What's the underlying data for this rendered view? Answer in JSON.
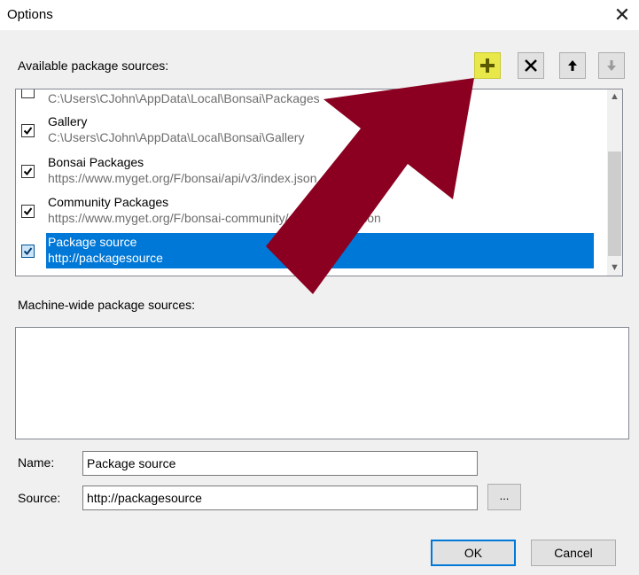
{
  "window": {
    "title": "Options",
    "close_glyph": "✕"
  },
  "available": {
    "label": "Available package sources:",
    "toolbar": [
      {
        "name": "add-source-button",
        "icon": "plus-icon"
      },
      {
        "name": "remove-source-button",
        "icon": "x-icon"
      },
      {
        "name": "move-up-button",
        "icon": "arrow-up-icon"
      },
      {
        "name": "move-down-button",
        "icon": "arrow-down-icon"
      }
    ],
    "items": [
      {
        "name": "",
        "path": "C:\\Users\\CJohn\\AppData\\Local\\Bonsai\\Packages",
        "checked": false
      },
      {
        "name": "Gallery",
        "path": "C:\\Users\\CJohn\\AppData\\Local\\Bonsai\\Gallery",
        "checked": true
      },
      {
        "name": "Bonsai Packages",
        "path": "https://www.myget.org/F/bonsai/api/v3/index.json",
        "checked": true
      },
      {
        "name": "Community Packages",
        "path": "https://www.myget.org/F/bonsai-community/api/v3/index.json",
        "checked": true
      },
      {
        "name": "Package source",
        "path": "http://packagesource",
        "checked": true,
        "selected": true
      }
    ]
  },
  "machine": {
    "label": "Machine-wide package sources:"
  },
  "form": {
    "name_label": "Name:",
    "name_value": "Package source",
    "source_label": "Source:",
    "source_value": "http://packagesource",
    "browse_label": "..."
  },
  "buttons": {
    "ok": "OK",
    "cancel": "Cancel"
  },
  "colors": {
    "accent": "#0078d7",
    "arrow": "#8b0020",
    "add_highlight": "#e8e84a"
  }
}
